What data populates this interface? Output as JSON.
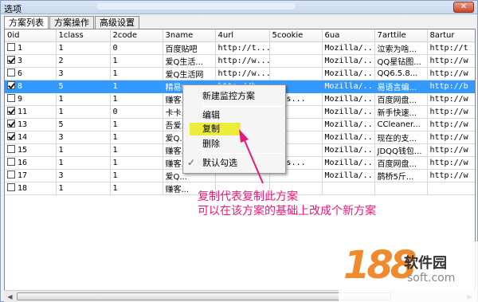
{
  "window": {
    "title": "选项",
    "close_label": "✕"
  },
  "tabs": [
    {
      "label": "方案列表",
      "active": true
    },
    {
      "label": "方案操作",
      "active": false
    },
    {
      "label": "高级设置",
      "active": false
    }
  ],
  "columns": [
    "0id",
    "1class",
    "2code",
    "3name",
    "4url",
    "5cookie",
    "6ua",
    "7arttile",
    "8artur"
  ],
  "rows": [
    {
      "checked": false,
      "cells": [
        "1",
        "1",
        "0",
        "百度贴吧",
        "http://t...",
        "",
        "Mozilla/...",
        "泣索为啥...",
        "http://t"
      ]
    },
    {
      "checked": true,
      "cells": [
        "3",
        "2",
        "1",
        "爱Q生活...",
        "http://w...",
        "",
        "Mozilla/...",
        "QQ星钻图...",
        "http://w"
      ]
    },
    {
      "checked": false,
      "cells": [
        "6",
        "3",
        "1",
        "爱Q生活网",
        "http://w...",
        "",
        "Mozilla/...",
        "QQ6.5.8...",
        "http://w"
      ]
    },
    {
      "checked": true,
      "selected": true,
      "cells": [
        "8",
        "5",
        "1",
        "精易ID",
        "http://b...",
        "",
        "Mozilla/...",
        "易语言编...",
        "http://b"
      ]
    },
    {
      "checked": false,
      "cells": [
        "9",
        "1",
        "1",
        "赚客...",
        "",
        "clas...",
        "Mozilla/...",
        "百度网盘...",
        "http://w"
      ]
    },
    {
      "checked": true,
      "cells": [
        "11",
        "1",
        "0",
        "卡卡...",
        "",
        "",
        "Mozilla/...",
        "新手快速...",
        "http://w"
      ]
    },
    {
      "checked": true,
      "cells": [
        "13",
        "5",
        "1",
        "吾爱...",
        "",
        "",
        "Mozilla/...",
        "CCleaner...",
        "http://w"
      ]
    },
    {
      "checked": true,
      "cells": [
        "14",
        "3",
        "1",
        "爱Q...",
        "",
        "",
        "Mozilla/...",
        "现在的支...",
        "http://w"
      ]
    },
    {
      "checked": false,
      "cells": [
        "15",
        "1",
        "1",
        "赚客...",
        "",
        "",
        "Mozilla/...",
        "JDQQ钱包...",
        "http://w"
      ]
    },
    {
      "checked": false,
      "cells": [
        "16",
        "1",
        "1",
        "赚客...",
        "",
        "clas...",
        "Mozilla/...",
        "百度网盘...",
        "http://w"
      ]
    },
    {
      "checked": false,
      "cells": [
        "17",
        "3",
        "1",
        "爱Q...",
        "",
        "",
        "Mozilla/...",
        "鹊桥5斤...",
        "http://w"
      ]
    },
    {
      "checked": false,
      "cells": [
        "18",
        "1",
        "1",
        "赚客...",
        "",
        "",
        "",
        "",
        ""
      ]
    }
  ],
  "context_menu": {
    "items": [
      {
        "label": "新建监控方案"
      },
      {
        "label": "编辑"
      },
      {
        "label": "复制",
        "highlighted": true
      },
      {
        "label": "删除"
      },
      {
        "label": "默认勾选",
        "checked": true
      }
    ],
    "checkmark": "✓"
  },
  "annotation": {
    "line1": "复制代表复制此方案",
    "line2": "可以在该方案的基础上改成个新方案",
    "color": "#e8187a"
  },
  "watermark": {
    "number": "188",
    "name": "软件园",
    "site": "soft.com"
  },
  "colors": {
    "selection": "#3399ff",
    "menu_highlight": "#ecec3a",
    "brand": "#f08a2c"
  }
}
